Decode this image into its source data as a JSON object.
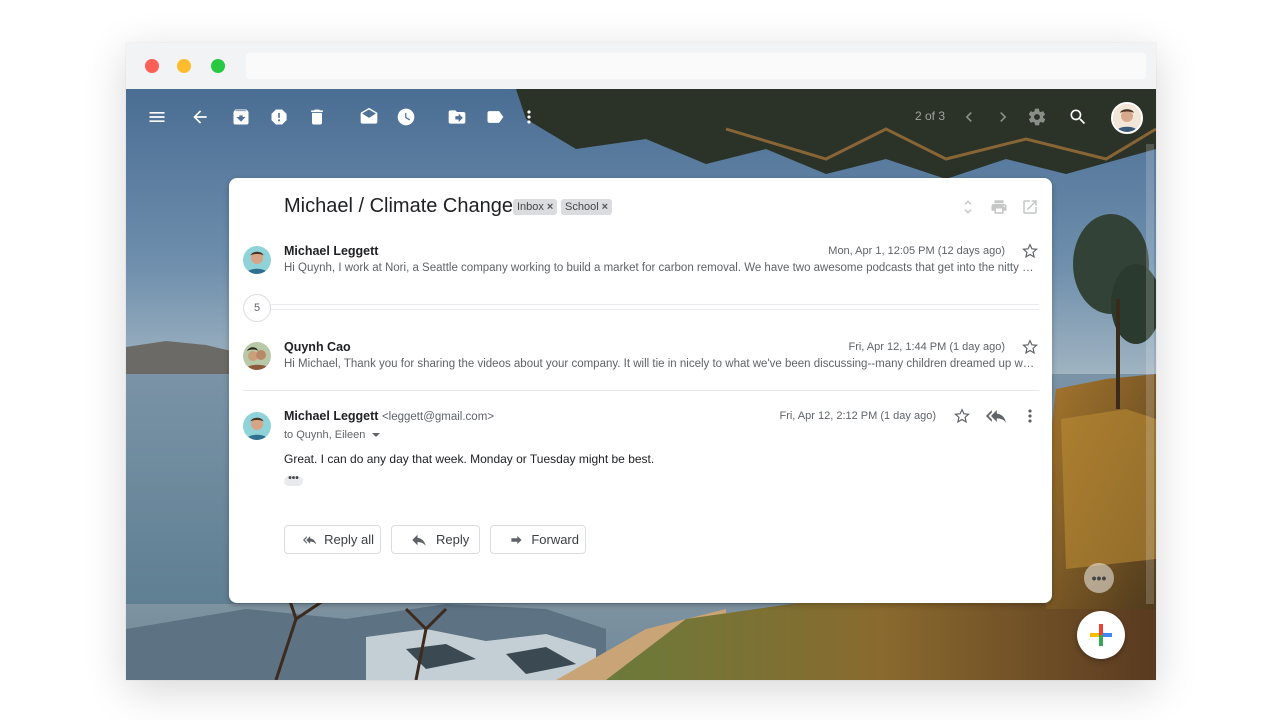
{
  "window": {
    "controls": [
      "close",
      "minimize",
      "zoom"
    ],
    "url": ""
  },
  "toolbar": {
    "icons": [
      "menu-icon",
      "back-arrow-icon",
      "archive-icon",
      "report-spam-icon",
      "delete-icon",
      "mark-unread-icon",
      "snooze-icon",
      "move-to-icon",
      "label-icon",
      "more-vert-icon"
    ],
    "pager": "2 of 3"
  },
  "thread": {
    "subject": "Michael / Climate Change",
    "labels": [
      {
        "name": "Inbox",
        "remove": "×"
      },
      {
        "name": "School",
        "remove": "×"
      }
    ],
    "collapsed_count": "5",
    "messages": [
      {
        "sender": "Michael Leggett",
        "date": "Mon, Apr 1, 12:05 PM (12 days ago)",
        "snippet": "Hi Quynh, I work at Nori, a Seattle company working to build a market for carbon removal. We have two awesome podcasts that get into the nitty gritty"
      },
      {
        "sender": "Quynh Cao",
        "date": "Fri, Apr 12, 1:44 PM (1 day ago)",
        "snippet": "Hi Michael, Thank you for sharing the videos about your company. It will tie in nicely to what we've been discussing--many children dreamed up ways to"
      }
    ],
    "expanded": {
      "sender": "Michael Leggett",
      "email": "<leggett@gmail.com>",
      "to": "to Quynh, Eileen",
      "date": "Fri, Apr 12, 2:12 PM (1 day ago)",
      "body": "Great. I can do any day that week. Monday or Tuesday might be best.",
      "trimmed": "•••"
    }
  },
  "actions": {
    "reply_all": "Reply all",
    "reply": "Reply",
    "forward": "Forward"
  },
  "chat_dots": "•••",
  "colors": {
    "accent_red": "#ea4335",
    "accent_blue": "#4285f4",
    "accent_yellow": "#fbbc04",
    "accent_green": "#34a853"
  }
}
